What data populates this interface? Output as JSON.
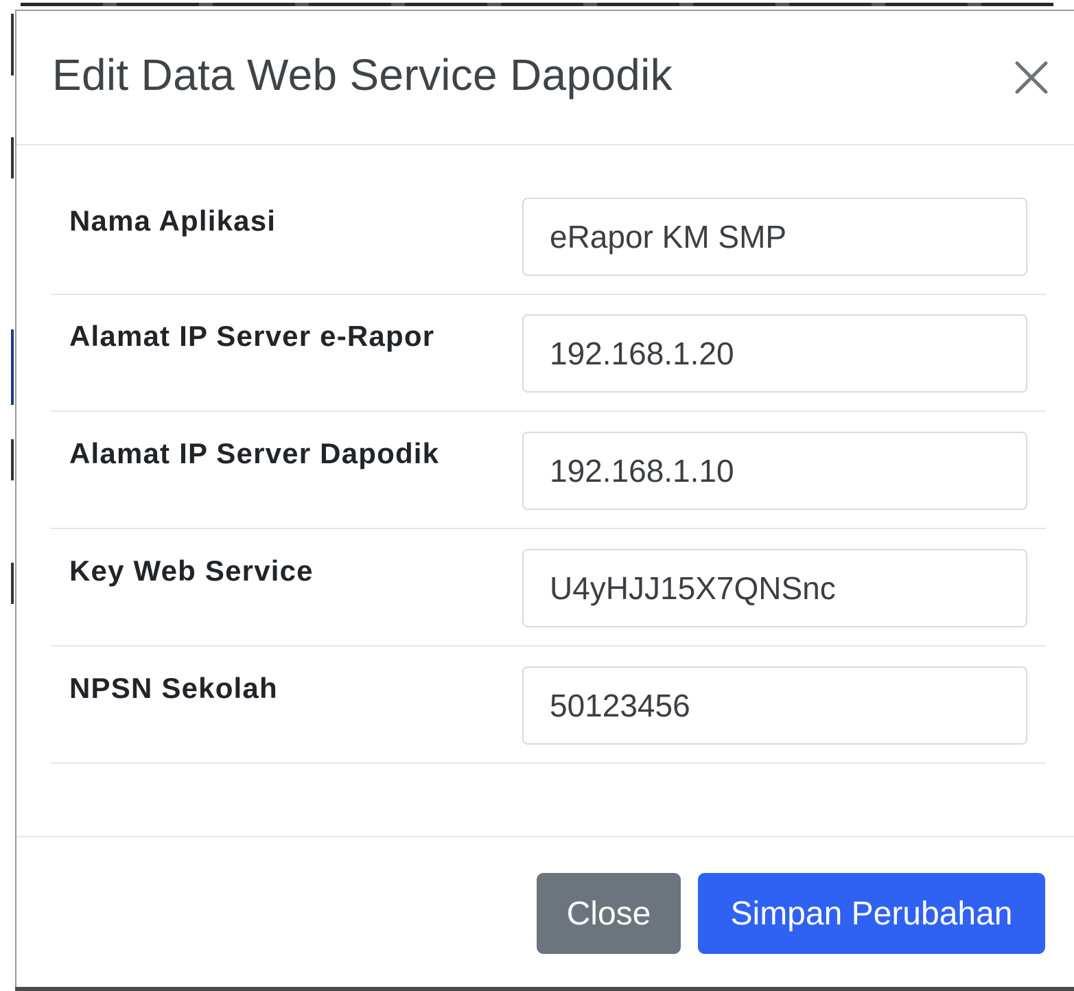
{
  "modal": {
    "title": "Edit Data Web Service Dapodik",
    "close_icon": "close-icon"
  },
  "form": {
    "fields": [
      {
        "label": "Nama Aplikasi",
        "value": "eRapor KM SMP"
      },
      {
        "label": "Alamat IP Server e-Rapor",
        "value": "192.168.1.20"
      },
      {
        "label": "Alamat IP Server Dapodik",
        "value": "192.168.1.10"
      },
      {
        "label": "Key Web Service",
        "value": "U4yHJJ15X7QNSnc"
      },
      {
        "label": "NPSN Sekolah",
        "value": "50123456"
      }
    ]
  },
  "footer": {
    "close_label": "Close",
    "save_label": "Simpan Perubahan"
  },
  "colors": {
    "primary": "#2f62f2",
    "secondary": "#6c757d",
    "text": "#212529"
  }
}
